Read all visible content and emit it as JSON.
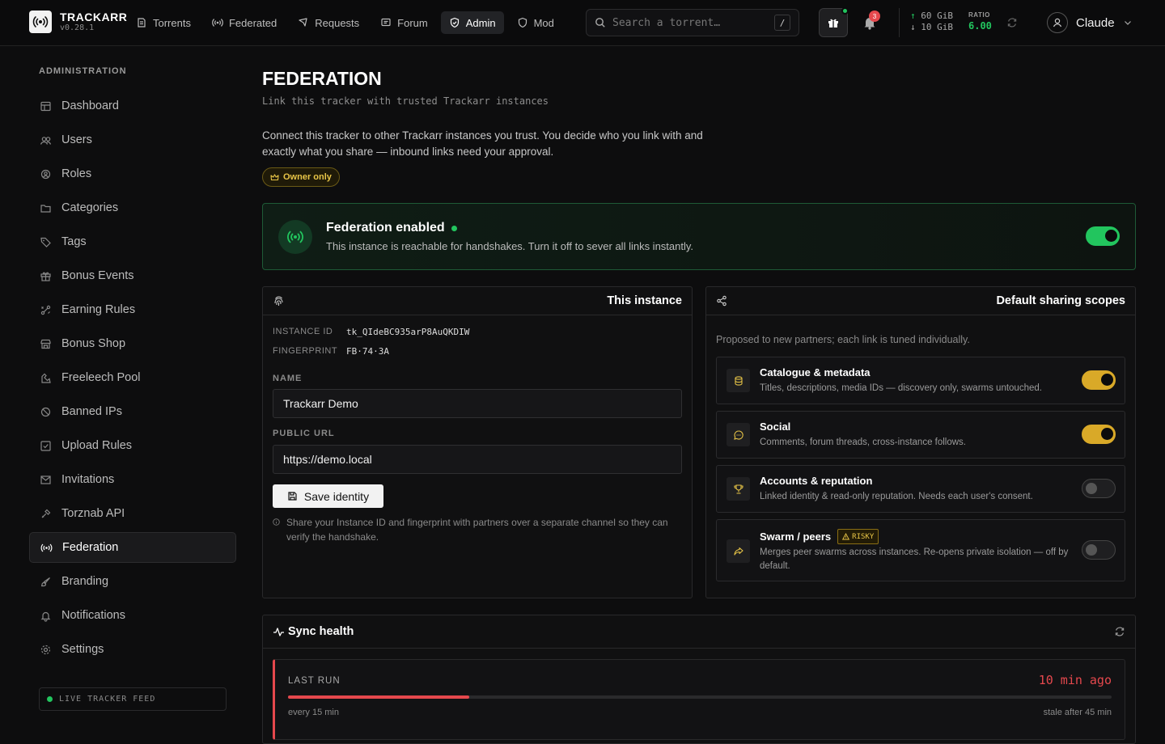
{
  "app": {
    "name": "TRACKARR",
    "version": "v0.28.1"
  },
  "nav": [
    {
      "label": "Torrents",
      "icon": "torrent-icon"
    },
    {
      "label": "Federated",
      "icon": "broadcast-icon"
    },
    {
      "label": "Requests",
      "icon": "request-icon"
    },
    {
      "label": "Forum",
      "icon": "forum-icon"
    },
    {
      "label": "Admin",
      "icon": "shield-check-icon",
      "active": true
    },
    {
      "label": "Mod",
      "icon": "shield-icon"
    }
  ],
  "search": {
    "placeholder": "Search a torrent…",
    "shortcut": "/"
  },
  "notifications": {
    "count": "3"
  },
  "stats": {
    "upload": "60 GiB",
    "download": "10 GiB",
    "ratio_label": "RATIO",
    "ratio": "6.00"
  },
  "user": {
    "name": "Claude"
  },
  "sidebar": {
    "title": "ADMINISTRATION",
    "items": [
      {
        "label": "Dashboard",
        "icon": "dashboard-icon"
      },
      {
        "label": "Users",
        "icon": "users-icon"
      },
      {
        "label": "Roles",
        "icon": "roles-icon"
      },
      {
        "label": "Categories",
        "icon": "folder-icon"
      },
      {
        "label": "Tags",
        "icon": "tag-icon"
      },
      {
        "label": "Bonus Events",
        "icon": "gift-icon"
      },
      {
        "label": "Earning Rules",
        "icon": "rules-icon"
      },
      {
        "label": "Bonus Shop",
        "icon": "shop-icon"
      },
      {
        "label": "Freeleech Pool",
        "icon": "pool-icon"
      },
      {
        "label": "Banned IPs",
        "icon": "ban-icon"
      },
      {
        "label": "Upload Rules",
        "icon": "checkbox-icon"
      },
      {
        "label": "Invitations",
        "icon": "mail-icon"
      },
      {
        "label": "Torznab API",
        "icon": "api-icon"
      },
      {
        "label": "Federation",
        "icon": "broadcast-icon",
        "active": true
      },
      {
        "label": "Branding",
        "icon": "brush-icon"
      },
      {
        "label": "Notifications",
        "icon": "bell-icon"
      },
      {
        "label": "Settings",
        "icon": "gear-icon"
      }
    ],
    "live_feed": "LIVE TRACKER FEED"
  },
  "page": {
    "title": "FEDERATION",
    "subtitle": "Link this tracker with trusted Trackarr instances",
    "description": "Connect this tracker to other Trackarr instances you trust. You decide who you link with and exactly what you share — inbound links need your approval.",
    "owner_badge": "Owner only"
  },
  "federation": {
    "title": "Federation enabled",
    "text": "This instance is reachable for handshakes. Turn it off to sever all links instantly.",
    "enabled": true
  },
  "instance": {
    "title": "This instance",
    "instance_id_label": "INSTANCE ID",
    "instance_id": "tk_QIdeBC935arP8AuQKDIW",
    "fingerprint_label": "FINGERPRINT",
    "fingerprint": "FB·74·3A",
    "name_label": "NAME",
    "name_value": "Trackarr Demo",
    "url_label": "PUBLIC URL",
    "url_value": "https://demo.local",
    "save_label": "Save identity",
    "hint": "Share your Instance ID and fingerprint with partners over a separate channel so they can verify the handshake."
  },
  "scopes": {
    "title": "Default sharing scopes",
    "intro": "Proposed to new partners; each link is tuned individually.",
    "items": [
      {
        "title": "Catalogue & metadata",
        "desc": "Titles, descriptions, media IDs — discovery only, swarms untouched.",
        "enabled": true,
        "icon": "database-icon"
      },
      {
        "title": "Social",
        "desc": "Comments, forum threads, cross-instance follows.",
        "enabled": true,
        "icon": "chat-icon"
      },
      {
        "title": "Accounts & reputation",
        "desc": "Linked identity & read-only reputation. Needs each user's consent.",
        "enabled": false,
        "icon": "trophy-icon"
      },
      {
        "title": "Swarm / peers",
        "badge": "RISKY",
        "desc": "Merges peer swarms across instances. Re-opens private isolation — off by default.",
        "enabled": false,
        "icon": "share-icon"
      }
    ]
  },
  "sync": {
    "title": "Sync health",
    "last_run_label": "LAST RUN",
    "last_run_value": "10 min ago",
    "interval": "every 15 min",
    "stale": "stale after 45 min",
    "progress": 0.22
  },
  "colors": {
    "accent_green": "#22c55e",
    "accent_yellow": "#d9a928",
    "danger": "#e5484d"
  }
}
